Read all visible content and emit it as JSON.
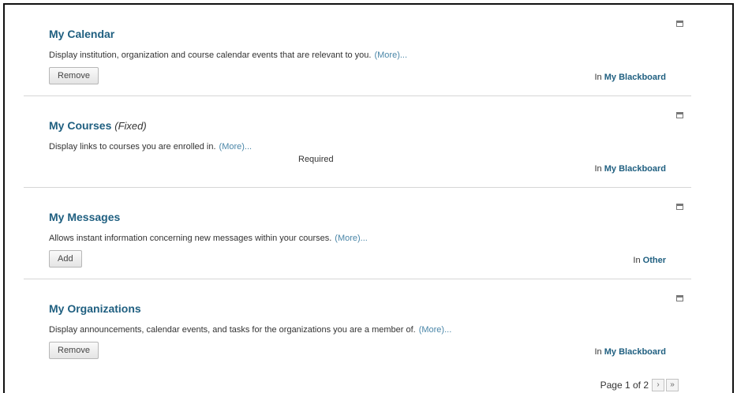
{
  "modules": [
    {
      "title": "My Calendar",
      "suffix": "",
      "description": "Display institution, organization and course calendar events that are relevant to you.",
      "more": "(More)...",
      "action": "Remove",
      "in_prefix": "In",
      "location": "My Blackboard"
    },
    {
      "title": "My Courses",
      "suffix": "(Fixed)",
      "description": "Display links to courses you are enrolled in.",
      "more": "(More)...",
      "status": "Required",
      "in_prefix": "In",
      "location": "My Blackboard"
    },
    {
      "title": "My Messages",
      "suffix": "",
      "description": "Allows instant information concerning new messages within your courses.",
      "more": "(More)...",
      "action": "Add",
      "in_prefix": "In",
      "location": "Other"
    },
    {
      "title": "My Organizations",
      "suffix": "",
      "description": "Display announcements, calendar events, and tasks for the organizations you are a member of.",
      "more": "(More)...",
      "action": "Remove",
      "in_prefix": "In",
      "location": "My Blackboard"
    }
  ],
  "pager": {
    "text": "Page 1 of 2",
    "next": "›",
    "last": "»"
  },
  "colors": {
    "title": "#1f5f80",
    "link": "#4a86a8"
  }
}
